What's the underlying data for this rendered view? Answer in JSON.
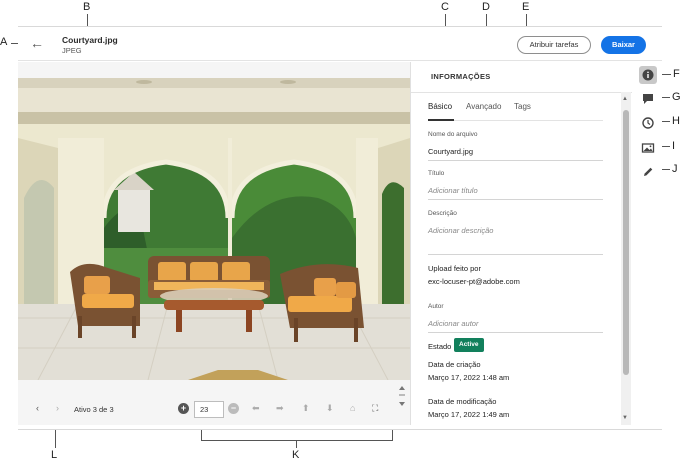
{
  "header": {
    "back_label": "←",
    "file_name": "Courtyard.jpg",
    "file_type": "JPEG",
    "assign_tasks_label": "Atribuir tarefas",
    "download_label": "Baixar"
  },
  "viewer": {
    "page_status": "Ativo 3 de 3",
    "zoom_value": "23",
    "photo_alt": "Courtyard with wicker furniture under arches"
  },
  "panel": {
    "title": "INFORMAÇÕES",
    "tabs": [
      {
        "label": "Básico",
        "active": true
      },
      {
        "label": "Avançado",
        "active": false
      },
      {
        "label": "Tags",
        "active": false
      }
    ],
    "fields": {
      "filename_label": "Nome do arquivo",
      "filename_value": "Courtyard.jpg",
      "title_label": "Título",
      "title_placeholder": "Adicionar título",
      "description_label": "Descrição",
      "description_placeholder": "Adicionar descrição",
      "upload_label": "Upload feito por",
      "upload_value": "exc-locuser-pt@adobe.com",
      "author_label": "Autor",
      "author_placeholder": "Adicionar autor",
      "state_label": "Estado",
      "state_badge": "Active",
      "created_label": "Data de criação",
      "created_value": "Março 17, 2022 1:48 am",
      "modified_label": "Data de modificação",
      "modified_value": "Março 17, 2022 1:49 am"
    }
  },
  "rail": {
    "icons": [
      "info-icon",
      "comment-icon",
      "clock-icon",
      "image-icon",
      "pencil-icon"
    ]
  },
  "callouts": {
    "A": "A",
    "B": "B",
    "C": "C",
    "D": "D",
    "E": "E",
    "F": "F",
    "G": "G",
    "H": "H",
    "I": "I",
    "J": "J",
    "K": "K",
    "L": "L"
  },
  "colors": {
    "primary": "#1473e6",
    "status_active": "#12805c",
    "rail_active": "#c8c8c8"
  }
}
